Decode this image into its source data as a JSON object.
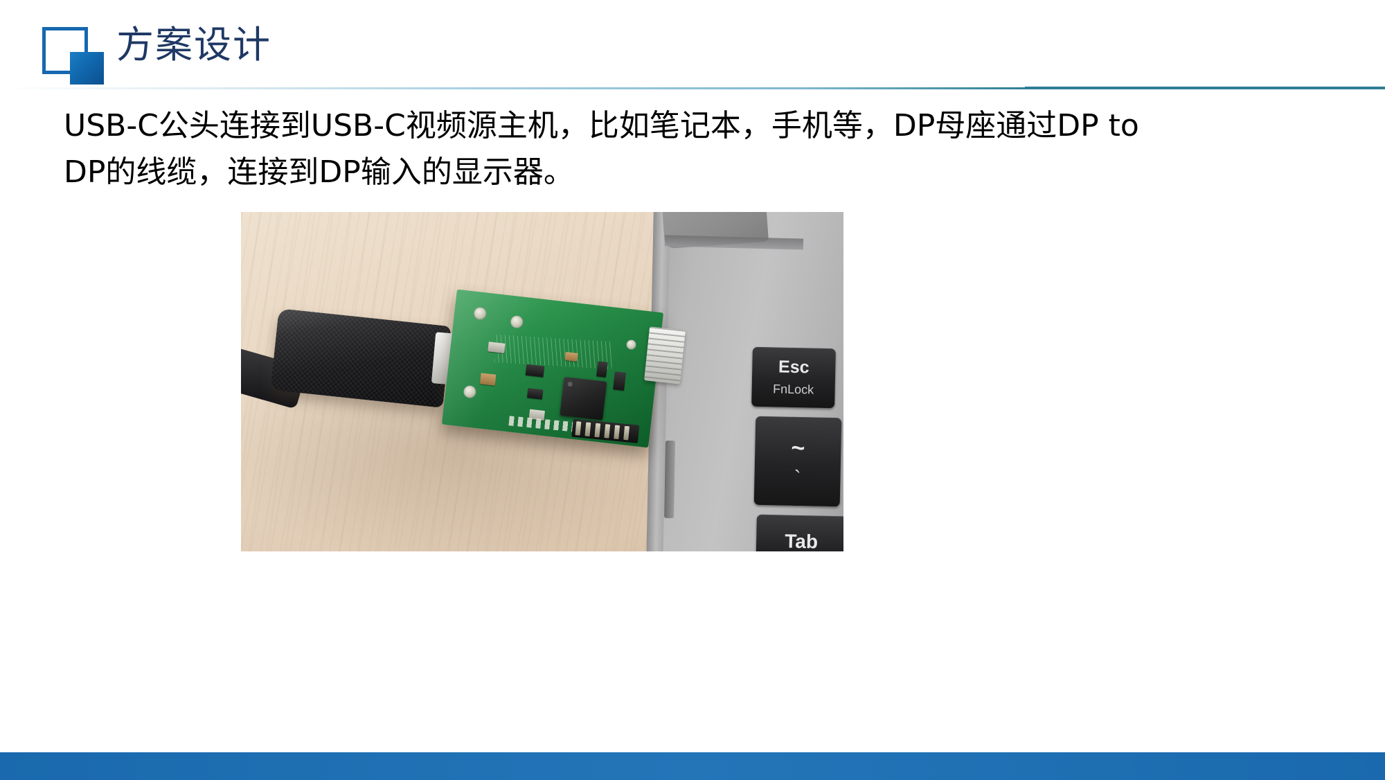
{
  "slide": {
    "title": "方案设计",
    "logo_icon": "overlapping-squares-logo",
    "accent_color": "#1668b0",
    "title_color": "#1f3864",
    "footer_color": "#1f6fb2"
  },
  "body": {
    "line1": "USB-C公头连接到USB-C视频源主机，比如笔记本，手机等，DP母座通过DP  to",
    "line2": "DP的线缆，连接到DP输入的显示器。"
  },
  "photo": {
    "caption": "",
    "alt": "USB-C male plug connected to a green adapter PCB which plugs into a laptop",
    "keys": [
      {
        "main": "Esc",
        "sub": "FnLock"
      },
      {
        "main": "~",
        "sub": "`"
      },
      {
        "main": "Tab",
        "sub": ""
      }
    ]
  }
}
